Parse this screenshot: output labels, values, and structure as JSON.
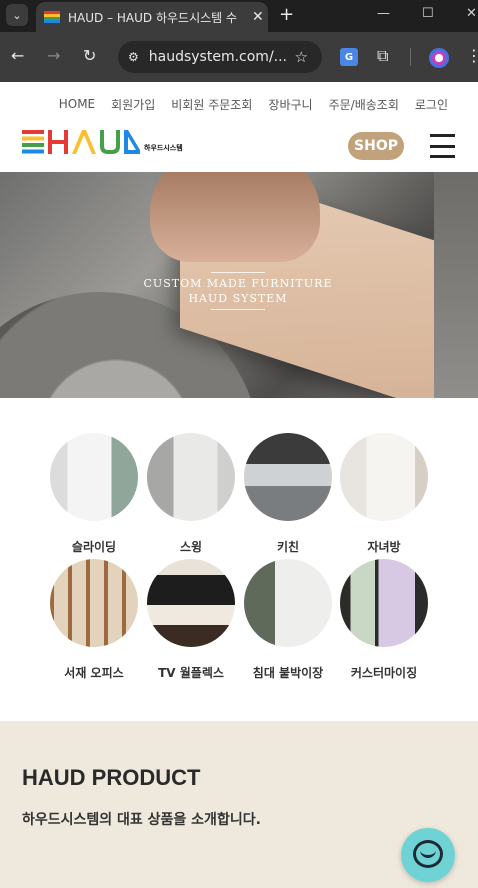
{
  "browser": {
    "tab_title": "HAUD – HAUD 하우드시스템 수",
    "url": "haudsystem.com/...",
    "tab_menu_icon": "chevron-down-icon",
    "new_tab": "+",
    "tab_close": "✕"
  },
  "site": {
    "top_nav": [
      "HOME",
      "회원가입",
      "비회원 주문조회",
      "장바구니",
      "주문/배송조회",
      "로그인"
    ],
    "logo_text": "HAUD",
    "logo_sub": "하우드시스템",
    "shop_label": "SHOP",
    "hero": {
      "line1": "CUSTOM MADE FURNITURE",
      "line2": "HAUD SYSTEM"
    },
    "categories": [
      {
        "label": "슬라이딩"
      },
      {
        "label": "스윙"
      },
      {
        "label": "키친"
      },
      {
        "label": "자녀방"
      },
      {
        "label": "서재 오피스"
      },
      {
        "label": "TV 월플렉스"
      },
      {
        "label": "침대 붙박이장"
      },
      {
        "label": "커스터마이징"
      }
    ],
    "product": {
      "title": "HAUD PRODUCT",
      "subtitle": "하우드시스템의 대표 상품을 소개합니다."
    }
  },
  "colors": {
    "accent_shop": "#c2a27a",
    "product_bg": "#efe9dd",
    "chat": "#6fd3d5"
  }
}
